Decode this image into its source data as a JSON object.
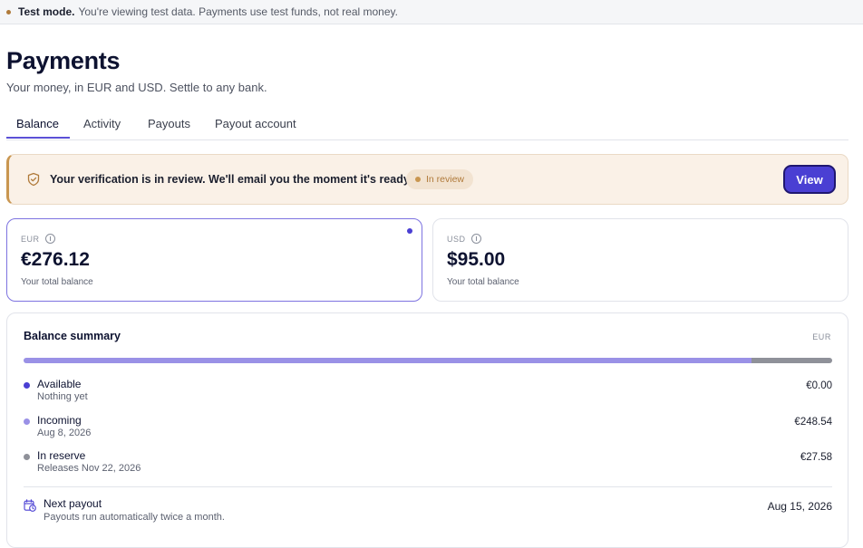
{
  "test_banner": {
    "label": "Test mode.",
    "message": "You're viewing test data. Payments use test funds, not real money."
  },
  "header": {
    "title": "Payments",
    "subtitle": "Your money, in EUR and USD. Settle to any bank."
  },
  "tabs": [
    {
      "label": "Balance",
      "active": true
    },
    {
      "label": "Activity",
      "active": false
    },
    {
      "label": "Payouts",
      "active": false
    },
    {
      "label": "Payout account",
      "active": false
    }
  ],
  "verification": {
    "message": "Your verification is in review. We'll email you the moment it's ready.",
    "badge": "In review",
    "button": "View"
  },
  "balances": [
    {
      "currency": "EUR",
      "amount": "€276.12",
      "label": "Your total balance",
      "selected": true
    },
    {
      "currency": "USD",
      "amount": "$95.00",
      "label": "Your total balance",
      "selected": false
    }
  ],
  "summary": {
    "title": "Balance summary",
    "currency": "EUR",
    "rows": [
      {
        "label": "Available",
        "sub": "Nothing yet",
        "value": "€0.00",
        "color": "#4a3fd3"
      },
      {
        "label": "Incoming",
        "sub": "Aug 8, 2026",
        "value": "€248.54",
        "color": "#9a91e6"
      },
      {
        "label": "In reserve",
        "sub": "Releases Nov 22, 2026",
        "value": "€27.58",
        "color": "#8f9199"
      }
    ],
    "bar_fractions": {
      "available": 0.0,
      "incoming": 0.9,
      "reserve": 0.1
    },
    "next_payout": {
      "label": "Next payout",
      "sub": "Payouts run automatically twice a month.",
      "value": "Aug 15, 2026"
    }
  },
  "colors": {
    "accent": "#4a3fd3",
    "incoming": "#9a91e6",
    "reserve": "#8f9199",
    "warning": "#c99650"
  },
  "icons": {
    "banner": "shield-check-icon",
    "info": "info-icon",
    "payout": "calendar-clock-icon"
  }
}
